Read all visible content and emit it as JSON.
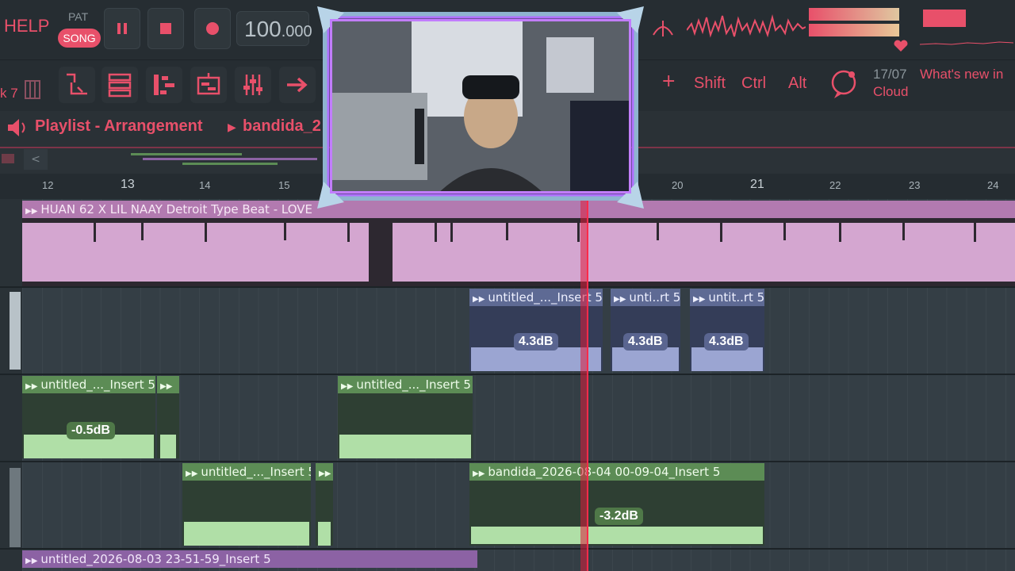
{
  "toolbar": {
    "help": "HELP",
    "pat_label": "PAT",
    "song_label": "SONG",
    "bpm_int": "100",
    "bpm_dec": ".000",
    "key_left": "k 7",
    "shift": "Shift",
    "ctrl": "Ctrl",
    "alt": "Alt",
    "plus": "+",
    "news_date": "17/07",
    "news_title": "What's new in",
    "news_title2": "Cloud"
  },
  "playlist": {
    "title": "Playlist - Arrangement",
    "breadcrumb": "bandida_2"
  },
  "ruler": {
    "ticks": [
      "12",
      "13",
      "14",
      "15",
      "20",
      "21",
      "22",
      "23",
      "24"
    ]
  },
  "clips": {
    "beat": "HUAN 62 X LIL NAAY Detroit Type Beat - LOVE",
    "blue1": "untitled_..._Insert 5",
    "blue2": "unti..rt 5",
    "blue3": "untit..rt 5",
    "blue_db": "4.3dB",
    "green1": "untitled_..._Insert 5",
    "green2": "",
    "green3": "untitled_..._Insert 5",
    "green_db1": "-0.5dB",
    "green4": "untitled_..._Insert 5",
    "green5": "",
    "green6": "bandida_2026-08-04 00-09-04_Insert 5",
    "green_db2": "-3.2dB",
    "purple1": "untitled_2026-08-03 23-51-59_Insert 5"
  },
  "colors": {
    "accent": "#e8506a",
    "beat_clip": "#b27ab0",
    "vocal_blue": "#5e6a94",
    "vocal_green": "#5c8c55",
    "playhead": "#ff2b4a"
  }
}
